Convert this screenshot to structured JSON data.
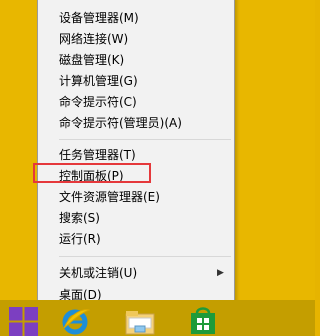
{
  "menu": {
    "items": [
      {
        "label": "设备管理器(M)"
      },
      {
        "label": "网络连接(W)"
      },
      {
        "label": "磁盘管理(K)"
      },
      {
        "label": "计算机管理(G)"
      },
      {
        "label": "命令提示符(C)"
      },
      {
        "label": "命令提示符(管理员)(A)"
      },
      {
        "label": "任务管理器(T)"
      },
      {
        "label": "控制面板(P)"
      },
      {
        "label": "文件资源管理器(E)"
      },
      {
        "label": "搜索(S)"
      },
      {
        "label": "运行(R)"
      },
      {
        "label": "关机或注销(U)",
        "submenu_icon": "chevron-right-icon"
      },
      {
        "label": "桌面(D)"
      }
    ],
    "highlighted_item": "控制面板(P)",
    "highlight_color": "#e5383b"
  },
  "taskbar": {
    "icons": [
      "windows-start-icon",
      "internet-explorer-icon",
      "file-explorer-icon",
      "windows-store-icon"
    ],
    "accent": "#7c3fc1"
  }
}
